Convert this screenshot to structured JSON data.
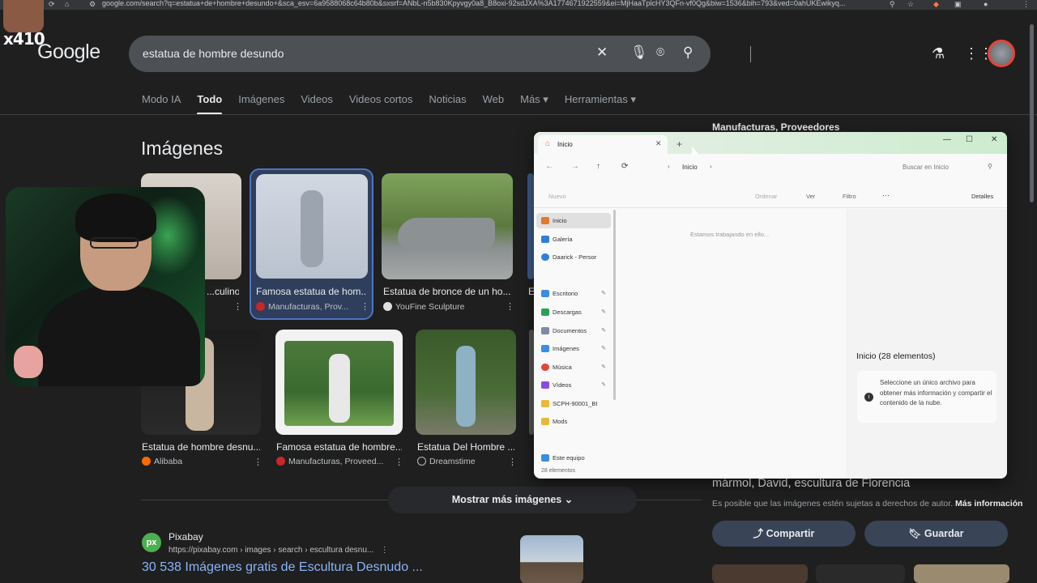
{
  "browser": {
    "url": "google.com/search?q=estatua+de+hombre+desundo+&sca_esv=6a9588068c64b80b&sxsrf=ANbL-n5b830Kpyvgy0a8_B8oxi-92sdJXA%3A1774671922559&ei=MjHaaTplcHY3QFn-vf0Qg&biw=1536&bih=793&ved=0ahUKEwikyq..."
  },
  "google": {
    "logo": "Google",
    "query": "estatua de hombre desundo",
    "tabs": [
      "Modo IA",
      "Todo",
      "Imágenes",
      "Videos",
      "Videos cortos",
      "Noticias",
      "Web",
      "Más ▾",
      "Herramientas ▾"
    ],
    "active_tab": "Todo",
    "section_title": "Imágenes"
  },
  "images_row1": [
    {
      "caption": "...culino ...",
      "source": ""
    },
    {
      "caption": "Famosa estatua de hom...",
      "source": "Manufacturas, Prov..."
    },
    {
      "caption": "Estatua de bronce de un ho...",
      "source": "YouFine Sculpture"
    },
    {
      "caption": "E",
      "source": ""
    }
  ],
  "images_row2": [
    {
      "caption": "Estatua de hombre desnu...",
      "source": "Alibaba"
    },
    {
      "caption": "Famosa estatua de hombre...",
      "source": "Manufacturas, Proveed..."
    },
    {
      "caption": "Estatua Del Hombre ...",
      "source": "Dreamstime"
    }
  ],
  "more_images": "Mostrar más imágenes",
  "result": {
    "favicon": "px",
    "site": "Pixabay",
    "url": "https://pixabay.com › images › search › escultura desnu...",
    "title": "30 538 Imágenes gratis de Escultura Desnudo ..."
  },
  "right_panel": {
    "top_title": "Manufacturas, Proveedores",
    "title": "mármol, David, escultura de Florencia",
    "note": "Es posible que las imágenes estén sujetas a derechos de autor.",
    "note_link": "Más información",
    "share": "Compartir",
    "save": "Guardar"
  },
  "stream": {
    "brand": "x410"
  },
  "explorer": {
    "tab_title": "Inicio",
    "breadcrumb": "Inicio",
    "search_placeholder": "Buscar en Inicio",
    "toolbar": {
      "new": "Nuevo",
      "sort": "Ordenar",
      "view": "Ver",
      "filter": "Filtro",
      "more": "···",
      "details": "Detalles"
    },
    "sidebar": [
      {
        "label": "Inicio",
        "color": "#e07a2f"
      },
      {
        "label": "Galería",
        "color": "#2f7fd9"
      },
      {
        "label": "Daarick - Persor",
        "color": "#2f7fd9"
      },
      {
        "label": "Escritorio",
        "color": "#3b8de0"
      },
      {
        "label": "Descargas",
        "color": "#2aa052"
      },
      {
        "label": "Documentos",
        "color": "#7a8ca8"
      },
      {
        "label": "Imágenes",
        "color": "#3b8de0"
      },
      {
        "label": "Música",
        "color": "#e0473b"
      },
      {
        "label": "Vídeos",
        "color": "#8a4be0"
      },
      {
        "label": "SCPH-90001_BI",
        "color": "#e8b83a"
      },
      {
        "label": "Mods",
        "color": "#e8b83a"
      },
      {
        "label": "Este equipo",
        "color": "#3b8de0"
      }
    ],
    "working_msg": "Estamos trabajando en ello...",
    "details_heading": "Inicio (28 elementos)",
    "details_text": "Seleccione un único archivo para obtener más información y compartir el contenido de la nube.",
    "status": "28 elementos"
  }
}
